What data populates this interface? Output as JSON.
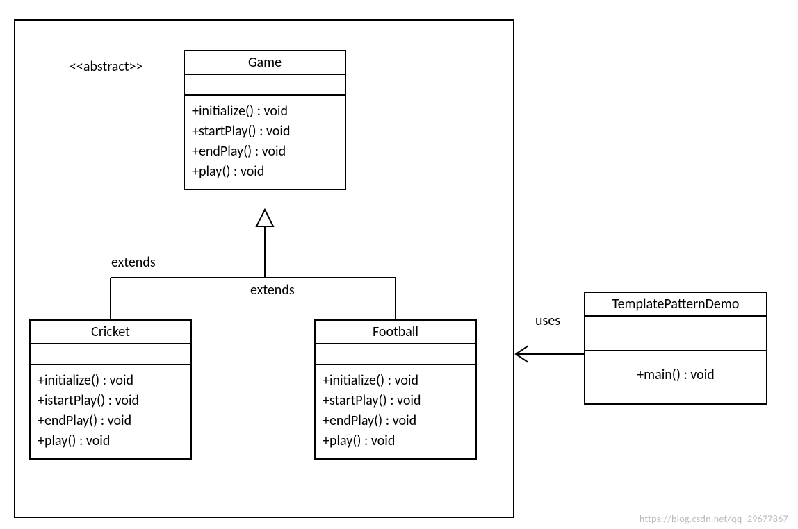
{
  "stereotype_abstract": "<<abstract>>",
  "game": {
    "name": "Game",
    "ops": [
      "+initialize() : void",
      "+startPlay() : void",
      "+endPlay() : void",
      "+play() : void"
    ]
  },
  "cricket": {
    "name": "Cricket",
    "ops": [
      "+initialize() : void",
      "+istartPlay() : void",
      "+endPlay() : void",
      "+play() : void"
    ]
  },
  "football": {
    "name": "Football",
    "ops": [
      "+initialize() : void",
      "+startPlay() : void",
      "+endPlay() : void",
      "+play() : void"
    ]
  },
  "demo": {
    "name": "TemplatePatternDemo",
    "ops": [
      "+main() : void"
    ]
  },
  "relations": {
    "extends_left": "extends",
    "extends_right": "extends",
    "uses": "uses"
  },
  "watermark": "https://blog.csdn.net/qq_29677867"
}
